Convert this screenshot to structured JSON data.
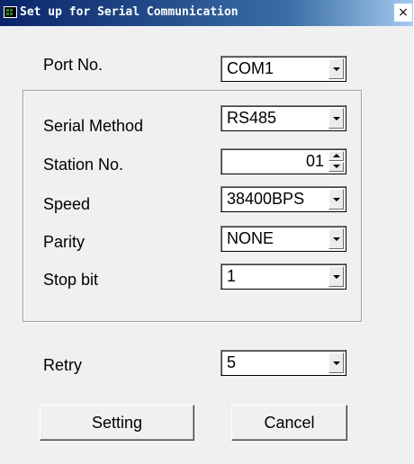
{
  "window": {
    "title": "Set up for Serial Communication",
    "close_glyph": "×"
  },
  "port": {
    "label": "Port No.",
    "value": "COM1"
  },
  "group": {
    "serial_method": {
      "label": "Serial Method",
      "value": "RS485"
    },
    "station": {
      "label": "Station No.",
      "value": "01"
    },
    "speed": {
      "label": "Speed",
      "value": "38400BPS"
    },
    "parity": {
      "label": "Parity",
      "value": "NONE"
    },
    "stop_bit": {
      "label": "Stop bit",
      "value": "1"
    }
  },
  "retry": {
    "label": "Retry",
    "value": "5"
  },
  "buttons": {
    "setting": "Setting",
    "cancel": "Cancel"
  },
  "colors": {
    "title_bar": "#0a246a",
    "dialog_bg": "#f0f0f0"
  }
}
